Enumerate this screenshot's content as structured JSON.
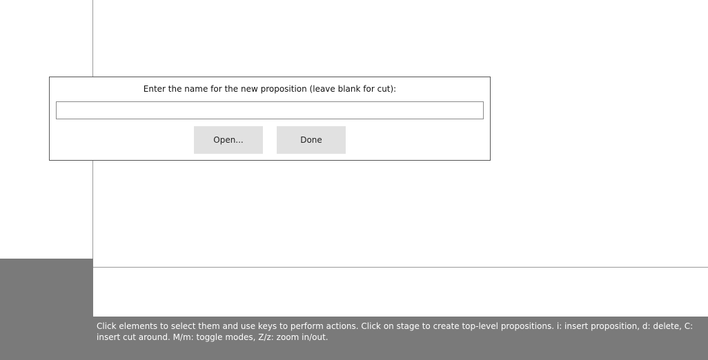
{
  "dialog": {
    "prompt": "Enter the name for the new proposition (leave blank for cut):",
    "input_value": "",
    "open_label": "Open...",
    "done_label": "Done"
  },
  "status_bar": {
    "help_text": "Click elements to select them and use keys to perform actions. Click on stage to create top-level propositions. i: insert proposition, d: delete, C: insert cut around. M/m: toggle modes, Z/z: zoom in/out."
  },
  "colors": {
    "panel_gray": "#7a7a7a",
    "button_bg": "#e1e1e1",
    "stage_border": "#9a9a9a"
  }
}
